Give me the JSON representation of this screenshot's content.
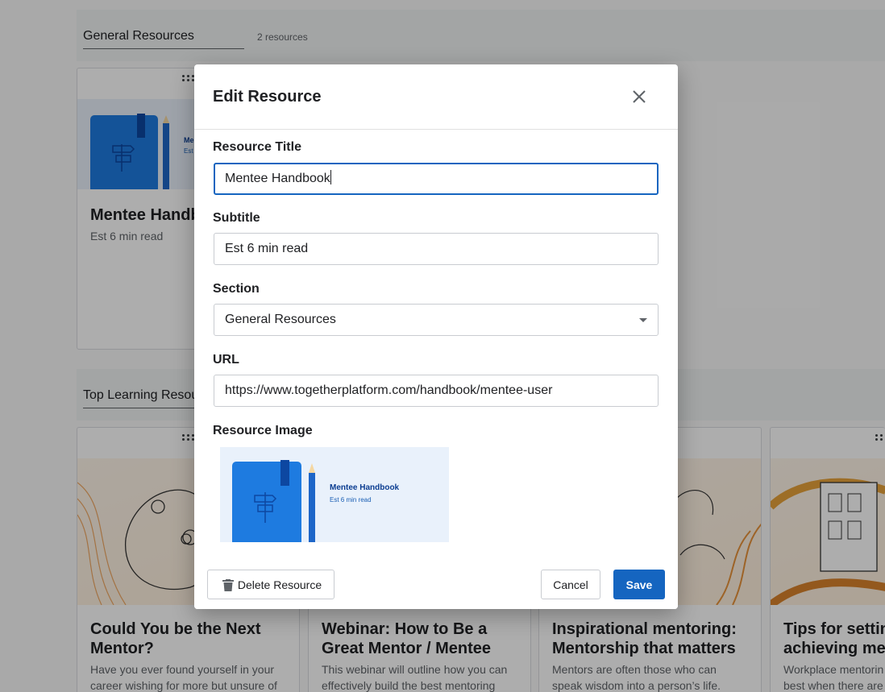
{
  "background": {
    "sections": [
      {
        "name": "General Resources",
        "count": "2 resources"
      },
      {
        "name": "Top Learning Resou"
      }
    ],
    "cards": [
      {
        "title": "Mentee Handb",
        "subtitle": "Est 6 min read",
        "thumb_label": "Me",
        "thumb_sub": "Est"
      },
      {
        "title": "Could You be the Next Mentor?",
        "desc": "Have you ever found yourself in your career wishing for more but unsure of"
      },
      {
        "title": "Webinar: How to Be a Great Mentor / Mentee",
        "desc": "This webinar will outline how you can effectively build the best mentoring"
      },
      {
        "title": "Inspirational mentoring: Mentorship that matters",
        "desc": "Mentors are often those who can speak wisdom into a person’s life."
      },
      {
        "title": "Tips for settin achieving men",
        "desc": "Workplace mentorin best when there are"
      }
    ]
  },
  "modal": {
    "title": "Edit Resource",
    "fields": {
      "title": {
        "label": "Resource Title",
        "value": "Mentee Handbook"
      },
      "subtitle": {
        "label": "Subtitle",
        "value": "Est 6 min read"
      },
      "section": {
        "label": "Section",
        "value": "General Resources"
      },
      "url": {
        "label": "URL",
        "value": "https://www.togetherplatform.com/handbook/mentee-user"
      },
      "image": {
        "label": "Resource Image",
        "preview_title": "Mentee Handbook",
        "preview_subtitle": "Est 6 min read"
      }
    },
    "footer": {
      "delete_label": "Delete Resource",
      "cancel_label": "Cancel",
      "save_label": "Save"
    }
  },
  "colors": {
    "primary": "#1565c0",
    "book_blue": "#1e7be0"
  }
}
